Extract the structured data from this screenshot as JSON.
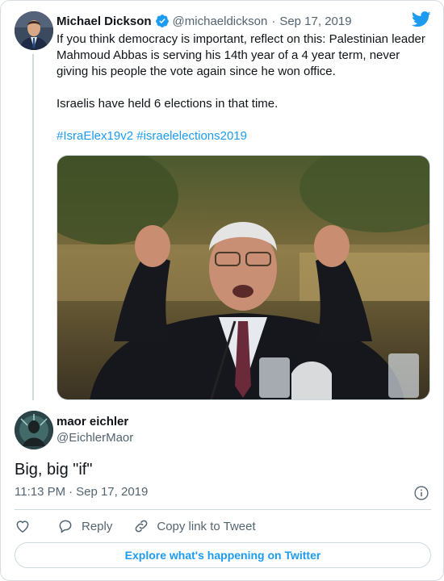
{
  "colors": {
    "accent": "#1d9bf0",
    "text_primary": "#0f1419",
    "text_secondary": "#536471",
    "border": "#cfd9de"
  },
  "icons": {
    "brand": "twitter-bird-icon",
    "verified": "verified-badge-icon",
    "info": "info-icon",
    "like": "heart-icon",
    "reply": "reply-bubble-icon",
    "copy": "link-icon"
  },
  "parent_tweet": {
    "author_name": "Michael Dickson",
    "handle": "@michaeldickson",
    "separator": "·",
    "date": "Sep 17, 2019",
    "body_line1": "If you think democracy is important, reflect on this: Palestinian leader Mahmoud Abbas is serving his 14th year of a 4 year term, never giving his people the vote again since he won office.",
    "body_line2": "Israelis have held 6 elections in that time.",
    "hashtags": [
      "#IsraElex19v2",
      "#israelelections2019"
    ]
  },
  "reply_tweet": {
    "author_name": "maor eichler",
    "handle": "@EichlerMaor",
    "text": "Big, big \"if\"",
    "time": "11:13 PM",
    "separator": "·",
    "date": "Sep 17, 2019"
  },
  "actions": {
    "reply_label": "Reply",
    "copy_label": "Copy link to Tweet"
  },
  "explore_label": "Explore what's happening on Twitter"
}
